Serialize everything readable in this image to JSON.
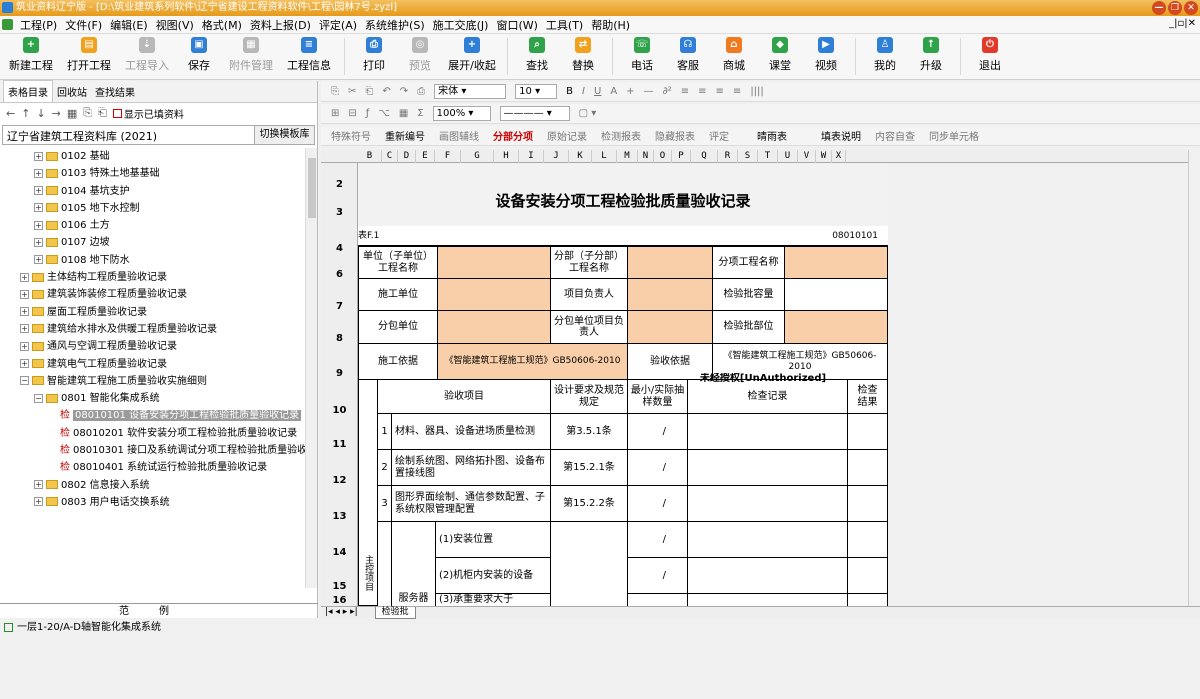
{
  "window": {
    "title": "筑业资料辽宁版 - [D:\\筑业建筑系列软件\\辽宁省建设工程资料软件\\工程\\园林7号.zyzl]",
    "controls": [
      "—",
      "❐",
      "✕"
    ]
  },
  "menu": [
    "工程(P)",
    "文件(F)",
    "编辑(E)",
    "视图(V)",
    "格式(M)",
    "资料上报(D)",
    "评定(A)",
    "系统维护(S)",
    "施工交底(J)",
    "窗口(W)",
    "工具(T)",
    "帮助(H)"
  ],
  "mdi_controls": "_|▫|✕",
  "ribbon": [
    {
      "label": "新建工程",
      "icon": "new-project-icon",
      "color": "#2fa24a",
      "glyph": "+",
      "disabled": false
    },
    {
      "label": "打开工程",
      "icon": "open-project-icon",
      "color": "#f0a21f",
      "glyph": "▤",
      "disabled": false
    },
    {
      "label": "工程导入",
      "icon": "import-icon",
      "color": "#b8b8b8",
      "glyph": "⇣",
      "disabled": true
    },
    {
      "label": "保存",
      "icon": "save-icon",
      "color": "#2f7fd6",
      "glyph": "▣",
      "disabled": false
    },
    {
      "label": "附件管理",
      "icon": "attachment-icon",
      "color": "#b8b8b8",
      "glyph": "▦",
      "disabled": true
    },
    {
      "label": "工程信息",
      "icon": "project-info-icon",
      "color": "#2f7fd6",
      "glyph": "≡",
      "disabled": false
    },
    {
      "label": "打印",
      "icon": "print-icon",
      "color": "#2f7fd6",
      "glyph": "⎙",
      "disabled": false
    },
    {
      "label": "预览",
      "icon": "preview-icon",
      "color": "#b8b8b8",
      "glyph": "◎",
      "disabled": true
    },
    {
      "label": "展开/收起",
      "icon": "expand-icon",
      "color": "#2f7fd6",
      "glyph": "+",
      "disabled": false
    },
    {
      "label": "查找",
      "icon": "find-icon",
      "color": "#2fa24a",
      "glyph": "⌕",
      "disabled": false
    },
    {
      "label": "替换",
      "icon": "replace-icon",
      "color": "#f0a21f",
      "glyph": "⇄",
      "disabled": false
    },
    {
      "label": "电话",
      "icon": "phone-icon",
      "color": "#2fa24a",
      "glyph": "☏",
      "disabled": false
    },
    {
      "label": "客服",
      "icon": "service-icon",
      "color": "#2f7fd6",
      "glyph": "☊",
      "disabled": false
    },
    {
      "label": "商城",
      "icon": "shop-icon",
      "color": "#f07a20",
      "glyph": "⌂",
      "disabled": false
    },
    {
      "label": "课堂",
      "icon": "class-icon",
      "color": "#2fa24a",
      "glyph": "◆",
      "disabled": false
    },
    {
      "label": "视频",
      "icon": "video-icon",
      "color": "#2f7fd6",
      "glyph": "▶",
      "disabled": false
    },
    {
      "label": "我的",
      "icon": "user-icon",
      "color": "#2f7fd6",
      "glyph": "♙",
      "disabled": false
    },
    {
      "label": "升级",
      "icon": "upgrade-icon",
      "color": "#2fa24a",
      "glyph": "↑",
      "disabled": false
    },
    {
      "label": "退出",
      "icon": "exit-icon",
      "color": "#e03a2a",
      "glyph": "⏻",
      "disabled": false
    }
  ],
  "left": {
    "tabs": [
      "表格目录",
      "回收站",
      "查找结果"
    ],
    "show_filled": "显示已填资料",
    "library": "辽宁省建筑工程资料库 (2021)",
    "switch_btn": "切换模板库",
    "tree": [
      {
        "lvl": 2,
        "t": "0102 基础",
        "type": "f",
        "pm": "+"
      },
      {
        "lvl": 2,
        "t": "0103 特殊土地基基础",
        "type": "f",
        "pm": "+"
      },
      {
        "lvl": 2,
        "t": "0104 基坑支护",
        "type": "f",
        "pm": "+"
      },
      {
        "lvl": 2,
        "t": "0105 地下水控制",
        "type": "f",
        "pm": "+"
      },
      {
        "lvl": 2,
        "t": "0106 土方",
        "type": "f",
        "pm": "+"
      },
      {
        "lvl": 2,
        "t": "0107 边坡",
        "type": "f",
        "pm": "+"
      },
      {
        "lvl": 2,
        "t": "0108 地下防水",
        "type": "f",
        "pm": "+"
      },
      {
        "lvl": 1,
        "t": "主体结构工程质量验收记录",
        "type": "f",
        "pm": "+"
      },
      {
        "lvl": 1,
        "t": "建筑装饰装修工程质量验收记录",
        "type": "f",
        "pm": "+"
      },
      {
        "lvl": 1,
        "t": "屋面工程质量验收记录",
        "type": "f",
        "pm": "+"
      },
      {
        "lvl": 1,
        "t": "建筑给水排水及供暖工程质量验收记录",
        "type": "f",
        "pm": "+"
      },
      {
        "lvl": 1,
        "t": "通风与空调工程质量验收记录",
        "type": "f",
        "pm": "+"
      },
      {
        "lvl": 1,
        "t": "建筑电气工程质量验收记录",
        "type": "f",
        "pm": "+"
      },
      {
        "lvl": 1,
        "t": "智能建筑工程施工质量验收实施细则",
        "type": "f",
        "pm": "-"
      },
      {
        "lvl": 2,
        "t": "0801 智能化集成系统",
        "type": "f",
        "pm": "-"
      },
      {
        "lvl": 3,
        "t": "08010101 设备安装分项工程检验批质量验收记录",
        "type": "c",
        "sel": true
      },
      {
        "lvl": 3,
        "t": "08010201 软件安装分项工程检验批质量验收记录",
        "type": "c"
      },
      {
        "lvl": 3,
        "t": "08010301 接口及系统调试分项工程检验批质量验收",
        "type": "c"
      },
      {
        "lvl": 3,
        "t": "08010401 系统试运行检验批质量验收记录",
        "type": "c"
      },
      {
        "lvl": 2,
        "t": "0802 信息接入系统",
        "type": "f",
        "pm": "+"
      },
      {
        "lvl": 2,
        "t": "0803 用户电话交换系统",
        "type": "f",
        "pm": "+"
      }
    ],
    "check_mark": "检",
    "legend_header": "范例",
    "legend_item": "一层1-20/A-D轴智能化集成系统"
  },
  "toolbars": {
    "tb1": [
      "⎘",
      "✂",
      "⎗",
      "↶",
      "↷",
      "⎙"
    ],
    "font": "宋体",
    "size": "10",
    "tb1b": [
      "A",
      "B",
      "I",
      "U",
      "A",
      "A",
      "+",
      "—",
      "∂",
      "⊕",
      "≡",
      "≡",
      "≡",
      "≡"
    ],
    "zoom": "100%",
    "tb3": [
      "特殊符号",
      "重新编号",
      "画图辅线",
      "分部分项",
      "原始记录",
      "检测报表",
      "隐藏报表",
      "评定",
      "晴雨表",
      "填表说明",
      "内容自查",
      "同步单元格"
    ]
  },
  "sheet": {
    "columns": [
      "B",
      "C",
      "D",
      "E",
      "F",
      "G",
      "H",
      "I",
      "J",
      "K",
      "L",
      "M",
      "N",
      "O",
      "P",
      "Q",
      "R",
      "S",
      "T",
      "U",
      "V",
      "W",
      "X"
    ],
    "rows": [
      "2",
      "3",
      "4",
      "6",
      "7",
      "8",
      "9",
      "10",
      "11",
      "12",
      "13",
      "14",
      "15",
      "16"
    ],
    "title": "设备安装分项工程检验批质量验收记录",
    "table_no": "表F.1",
    "code": "08010101",
    "c_unit": "单位（子单位）工程名称",
    "c_part": "分部（子分部）工程名称",
    "c_item": "分项工程名称",
    "c_builder": "施工单位",
    "c_leader": "项目负责人",
    "c_capacity": "检验批容量",
    "c_sub": "分包单位",
    "c_subleader": "分包单位项目负责人",
    "c_location": "检验批部位",
    "c_basis": "施工依据",
    "v_basis": "《智能建筑工程施工规范》GB50606-2010",
    "c_accept": "验收依据",
    "v_accept": "《智能建筑工程施工规范》GB50606-2010",
    "watermark": "未经授权[UnAuthorized]",
    "h_items": "验收项目",
    "h_req": "设计要求及规范规定",
    "h_min": "最小/实际抽样数量",
    "h_record": "检查记录",
    "h_result": "检查结果",
    "r1_no": "1",
    "r1": "材料、器具、设备进场质量检测",
    "r1_req": "第3.5.1条",
    "r2_no": "2",
    "r2": "绘制系统图、网络拓扑图、设备布置接线图",
    "r2_req": "第15.2.1条",
    "r3_no": "3",
    "r3": "图形界面绘制、通信参数配置、子系统权限管理配置",
    "r3_req": "第15.2.2条",
    "main_ctrl": "主控项目",
    "server": "服务器",
    "s1": "(1)安装位置",
    "s2": "(2)机柜内安装的设备",
    "s3": "(3)承重要求大于",
    "slash": "/",
    "sheet_tab": "检验批"
  }
}
